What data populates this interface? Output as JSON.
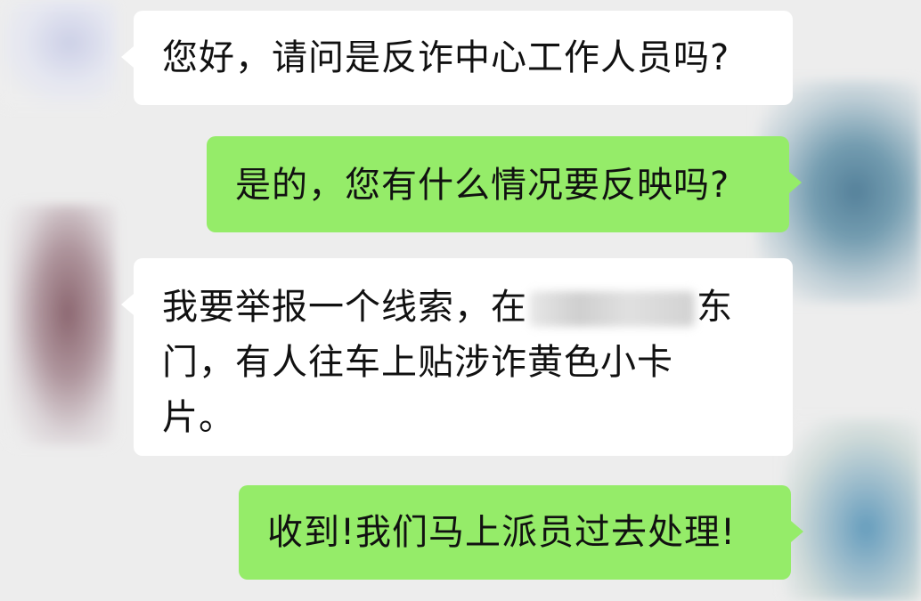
{
  "messages": [
    {
      "side": "incoming",
      "text": "您好，请问是反诈中心工作人员吗?"
    },
    {
      "side": "outgoing",
      "text": "是的，您有什么情况要反映吗?"
    },
    {
      "side": "incoming",
      "text_before_redaction": "我要举报一个线索，在",
      "text_after_redaction": "东",
      "line2": "门，有人往车上贴涉诈黄色小卡",
      "line3": "片。"
    },
    {
      "side": "outgoing",
      "text": "收到!我们马上派员过去处理!"
    }
  ]
}
